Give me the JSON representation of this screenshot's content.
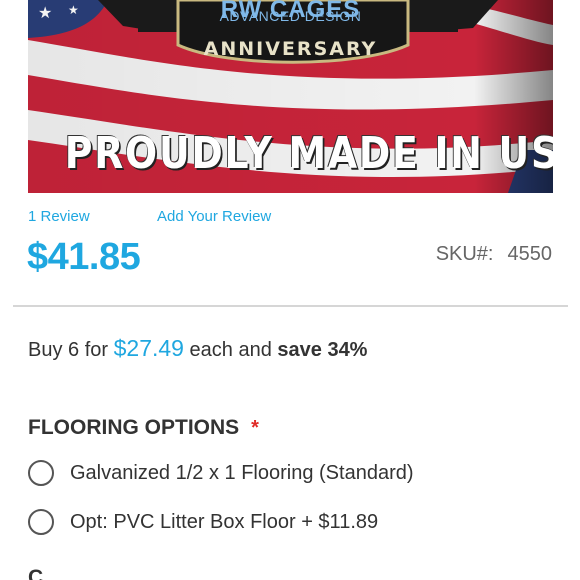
{
  "banner": {
    "logo_text": "RW CAGES",
    "logo_subtext": "ADVANCED DESIGN",
    "anniversary_text": "ANNIVERSARY",
    "tagline": "PROUDLY MADE IN USA"
  },
  "reviews": {
    "count_label": "1  Review",
    "add_label": "Add Your Review"
  },
  "product": {
    "price": "$41.85",
    "sku_label": "SKU#:",
    "sku_value": "4550"
  },
  "tier_price": {
    "prefix": "Buy 6 for ",
    "price": "$27.49",
    "middle": " each and ",
    "save": "save 34%"
  },
  "flooring_options": {
    "title": "FLOORING OPTIONS",
    "required_mark": "*",
    "options": [
      {
        "label": "Galvanized 1/2 x 1 Flooring (Standard)"
      },
      {
        "label": "Opt: PVC Litter Box Floor + $11.89"
      }
    ]
  },
  "next_section": {
    "title_partial": "C"
  },
  "colors": {
    "accent": "#1fa7e0",
    "required": "#e02b27",
    "text": "#333333"
  }
}
